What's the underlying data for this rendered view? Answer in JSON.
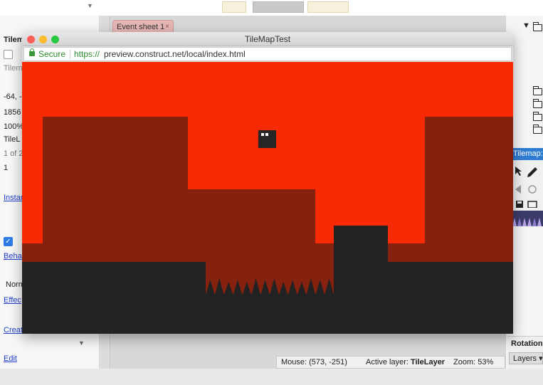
{
  "editor": {
    "doc_tab": {
      "label": "Event sheet 1",
      "close_glyph": "×"
    },
    "left_panel": {
      "rows": [
        {
          "text": "Tilem",
          "kind": "text"
        },
        {
          "text": "Tilem",
          "kind": "text"
        },
        {
          "text": "-64, -",
          "kind": "text"
        },
        {
          "text": "1856",
          "kind": "text"
        },
        {
          "text": "100%",
          "kind": "text"
        },
        {
          "text": "TileL",
          "kind": "text"
        },
        {
          "text": "1 of 2",
          "kind": "text"
        },
        {
          "text": "1",
          "kind": "text"
        },
        {
          "text": "Instan",
          "kind": "link"
        },
        {
          "text": "Beha",
          "kind": "link"
        },
        {
          "text": "Norm",
          "kind": "text"
        },
        {
          "text": "Effec",
          "kind": "link"
        },
        {
          "text": "Creat",
          "kind": "link"
        },
        {
          "text": "Edit",
          "kind": "link"
        }
      ]
    },
    "right_panel": {
      "tree_arrow": "▼",
      "tilemap_title": "Tilemap: T",
      "rotation_label": "Rotation",
      "layers_button": "Layers ▾"
    },
    "status": {
      "mouse_label": "Mouse:",
      "mouse_value": "(573, -251)",
      "layer_label": "Active layer:",
      "layer_value": "TileLayer",
      "zoom_label": "Zoom:",
      "zoom_value": "53%"
    }
  },
  "browser": {
    "title": "TileMapTest",
    "secure_label": "Secure",
    "url_scheme": "https://",
    "url_rest": "preview.construct.net/local/index.html",
    "traffic_colors": [
      "#fc5f57",
      "#fdbc2e",
      "#28c840"
    ]
  },
  "game": {
    "colors": {
      "sky": "#f72a05",
      "wall": "#84210f",
      "ground": "#222222",
      "player": "#262626",
      "eyes": "#ffffff"
    },
    "spike_count": 14
  },
  "icons": [
    "lock-icon",
    "folder-icon",
    "chevron-down-icon",
    "close-icon",
    "pencil-icon",
    "save-icon",
    "rotate-icon"
  ]
}
